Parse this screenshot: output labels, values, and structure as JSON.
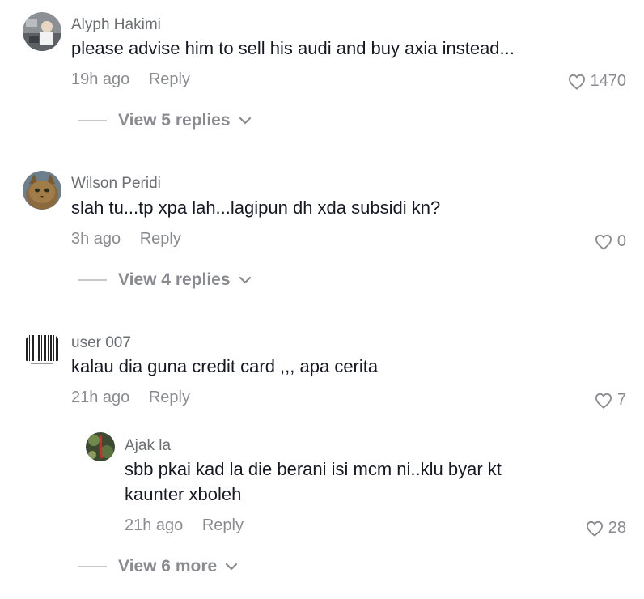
{
  "comments": [
    {
      "username": "Alyph Hakimi",
      "text": "please advise him to sell his audi and buy axia instead...",
      "time": "19h ago",
      "reply_label": "Reply",
      "likes": "1470",
      "view_replies": "View 5 replies",
      "avatar_icon": "profile-photo-avatar"
    },
    {
      "username": "Wilson Peridi",
      "text": "slah tu...tp xpa lah...lagipun dh xda subsidi kn?",
      "time": "3h ago",
      "reply_label": "Reply",
      "likes": "0",
      "view_replies": "View 4 replies",
      "avatar_icon": "cat-avatar"
    },
    {
      "username": "user 007",
      "text": "kalau dia guna credit card ,,, apa cerita",
      "time": "21h ago",
      "reply_label": "Reply",
      "likes": "7",
      "avatar_icon": "barcode-avatar",
      "replies": [
        {
          "username": "Ajak la",
          "text_line1": "sbb pkai kad la die berani isi mcm ni..klu byar kt",
          "text_line2": "kaunter xboleh",
          "time": "21h ago",
          "reply_label": "Reply",
          "likes": "28",
          "avatar_icon": "plant-avatar"
        }
      ],
      "view_more": "View 6 more"
    }
  ],
  "colors": {
    "text": "#161823",
    "muted": "#8a8b91",
    "username": "#6b6d72"
  }
}
